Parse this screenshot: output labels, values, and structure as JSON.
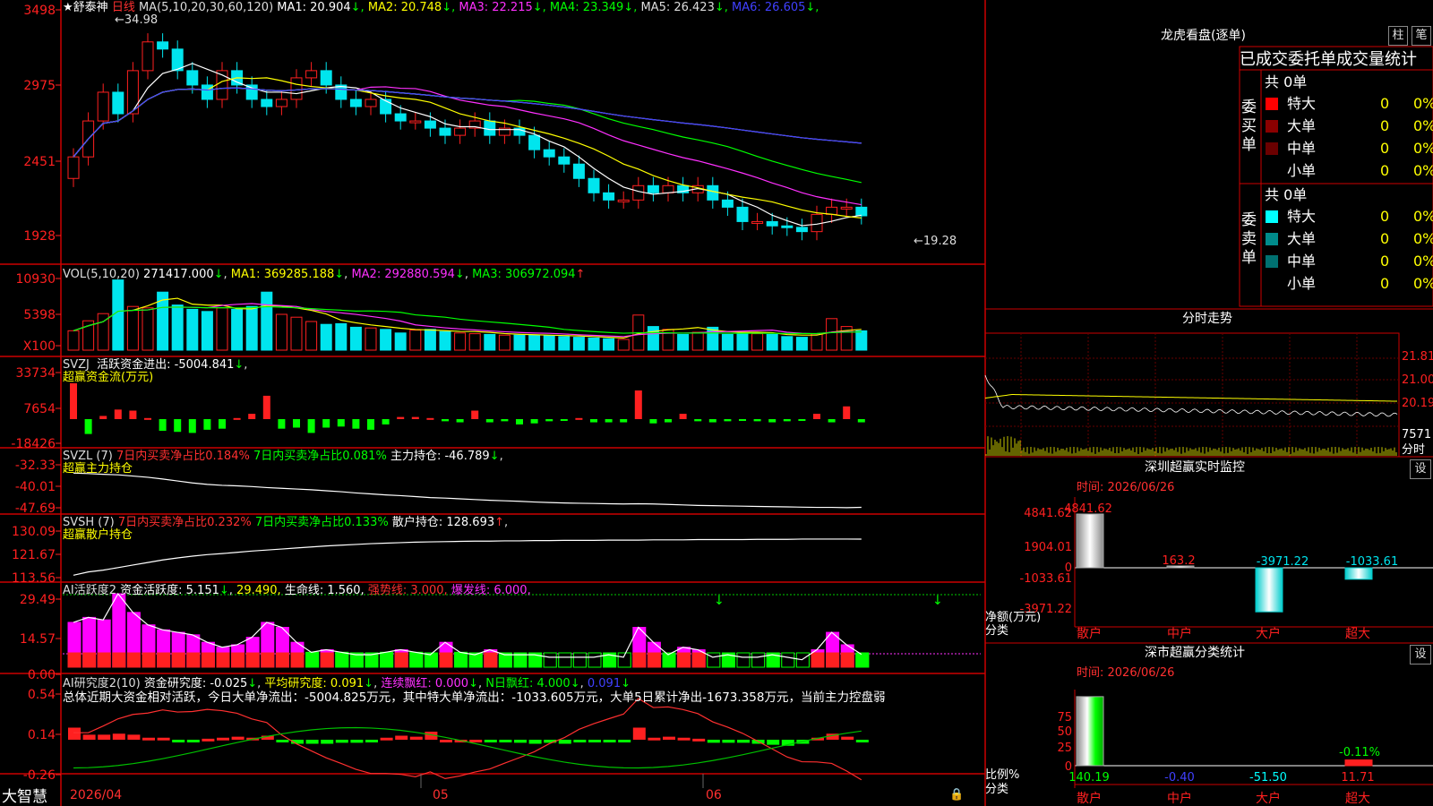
{
  "app": {
    "name": "大智慧",
    "date_tick": "2026/04",
    "month_labels": [
      "05",
      "06"
    ]
  },
  "main": {
    "stock": "舒泰神",
    "period": "日线",
    "ma_prefix": "MA(5,10,20,30,60,120)",
    "ma": [
      {
        "label": "MA1:",
        "value": "20.904",
        "arrow": "↓",
        "color": "#ffffff"
      },
      {
        "label": "MA2:",
        "value": "20.748",
        "arrow": "↓",
        "color": "#ffff00"
      },
      {
        "label": "MA3:",
        "value": "22.215",
        "arrow": "↓",
        "color": "#ff30ff"
      },
      {
        "label": "MA4:",
        "value": "23.349",
        "arrow": "↓",
        "color": "#00ff00"
      },
      {
        "label": "MA5:",
        "value": "26.423",
        "arrow": "↓",
        "color": "#dddddd"
      },
      {
        "label": "MA6:",
        "value": "26.605",
        "arrow": "↓",
        "color": "#4040ff"
      }
    ],
    "yticks": [
      "3498",
      "2975",
      "2451",
      "1928"
    ],
    "high_label": "34.98",
    "low_label": "19.28"
  },
  "vol": {
    "title": "VOL(5,10,20)",
    "value": "271417.000",
    "arrow": "↓",
    "ma1": "MA1: 369285.188",
    "ma2": "MA2: 292880.594",
    "ma3": "MA3: 306972.094",
    "yticks": [
      "10930",
      "5398",
      "X100"
    ]
  },
  "svzj": {
    "title": "SVZJ",
    "desc": "活跃资金进出: -5004.841",
    "sub": "超赢资金流(万元)",
    "yticks": [
      "33734",
      "7654",
      "-18426"
    ]
  },
  "svzl": {
    "title": "SVZL (7)",
    "a": "7日内买卖净占比0.184%",
    "b": "7日内买卖净占比0.081%",
    "c": "主力持仓: -46.789",
    "sub": "超赢主力持仓",
    "yticks": [
      "-32.33",
      "-40.01",
      "-47.69"
    ]
  },
  "svsh": {
    "title": "SVSH (7)",
    "a": "7日内买卖净占比0.232%",
    "b": "7日内买卖净占比0.133%",
    "c": "散户持仓: 128.693",
    "sub": "超赢散户持仓",
    "yticks": [
      "130.09",
      "121.67",
      "113.56"
    ]
  },
  "ai_active": {
    "title": "AI活跃度2",
    "a": "资金活跃度: 5.151",
    "b": "29.490,",
    "c": "生命线: 1.560,",
    "d": "强势线: 3.000,",
    "e": "爆发线: 6.000,",
    "yticks": [
      "29.49",
      "14.57",
      "0.00"
    ]
  },
  "ai_research": {
    "title": "AI研究度2(10)",
    "a": "资金研究度: -0.025",
    "b": "平均研究度: 0.091",
    "c": "连续飘红: 0.000",
    "d": "N日飘红: 4.000",
    "e": "0.091",
    "summary": "总体近期大资金相对活跃，今日大单净流出：-5004.825万元，其中特大单净流出：-1033.605万元，大单5日累计净出-1673.358万元，当前主力控盘弱",
    "yticks": [
      "0.54",
      "0.14",
      "-0.26"
    ]
  },
  "right": {
    "lhb_title": "龙虎看盘(逐单)",
    "btn_zhu": "柱",
    "btn_bi": "笔",
    "stat_title": "已成交委托单成交量统计",
    "buy": {
      "label": [
        "委",
        "买",
        "单"
      ],
      "total": "共 0单",
      "rows": [
        {
          "name": "特大",
          "vol": "0",
          "pct": "0%",
          "color": "#ff0000"
        },
        {
          "name": "大单",
          "vol": "0",
          "pct": "0%",
          "color": "#8b0000"
        },
        {
          "name": "中单",
          "vol": "0",
          "pct": "0%",
          "color": "#6b0000"
        },
        {
          "name": "小单",
          "vol": "0",
          "pct": "0%",
          "color": ""
        }
      ]
    },
    "sell": {
      "label": [
        "委",
        "卖",
        "单"
      ],
      "total": "共 0单",
      "rows": [
        {
          "name": "特大",
          "vol": "0",
          "pct": "0%",
          "color": "#00ffff"
        },
        {
          "name": "大单",
          "vol": "0",
          "pct": "0%",
          "color": "#008b8b"
        },
        {
          "name": "中单",
          "vol": "0",
          "pct": "0%",
          "color": "#007070"
        },
        {
          "name": "小单",
          "vol": "0",
          "pct": "0%",
          "color": ""
        }
      ]
    },
    "fs_title": "分时走势",
    "fs_yticks": [
      "21.81",
      "21.00",
      "20.19",
      "7571",
      "分时"
    ],
    "monitor": {
      "title": "深圳超赢实时监控",
      "btn": "设",
      "time": "时间: 2026/06/26",
      "yticks": [
        "4841.62",
        "1904.01",
        "0",
        "-1033.61",
        "-3971.22"
      ],
      "unit": "净额(万元)",
      "unit2": "分类",
      "bars": [
        {
          "name": "散户",
          "value": 4841.62,
          "label": "4841.62"
        },
        {
          "name": "中户",
          "value": 163.2,
          "label": "163.2"
        },
        {
          "name": "大户",
          "value": -3971.22,
          "label": "-3971.22"
        },
        {
          "name": "超大",
          "value": -1033.61,
          "label": "-1033.61"
        }
      ]
    },
    "cls": {
      "title": "深市超赢分类统计",
      "btn": "设",
      "time": "时间: 2026/06/26",
      "yticks": [
        "75",
        "50",
        "25",
        "0"
      ],
      "unit": "比例%",
      "unit2": "分类",
      "top_label": "-0.11%",
      "bars": [
        {
          "name": "散户",
          "value": 140.19,
          "label": "140.19"
        },
        {
          "name": "中户",
          "value": -0.4,
          "label": "-0.40"
        },
        {
          "name": "大户",
          "value": -51.5,
          "label": "-51.50"
        },
        {
          "name": "超大",
          "value": 11.71,
          "label": "11.71"
        }
      ]
    }
  },
  "chart_data": [
    {
      "type": "candlestick",
      "title": "舒泰神 日线",
      "ylim": [
        19.28,
        34.98
      ],
      "high": 34.98,
      "low": 19.28,
      "closes": [
        25,
        27.5,
        29.5,
        28,
        31,
        33,
        32.5,
        31,
        30,
        29,
        31,
        30,
        29,
        28.5,
        29,
        30.5,
        31,
        30,
        29,
        28.5,
        29,
        28,
        27.5,
        27.5,
        27,
        26.5,
        27,
        27.5,
        26.5,
        27,
        26.5,
        25.5,
        25,
        24.5,
        23.5,
        22.5,
        22,
        22,
        23,
        22.5,
        23,
        22.5,
        23,
        22,
        21.5,
        20.5,
        20.5,
        20.2,
        20.1,
        19.8,
        21,
        21.5,
        21.5,
        20.9
      ]
    },
    {
      "type": "bar",
      "title": "VOL(5,10,20)",
      "values": [
        2710,
        4100,
        5100,
        9800,
        6100,
        5900,
        8100,
        6300,
        5700,
        5400,
        5900,
        5700,
        6100,
        8100,
        5000,
        4600,
        4000,
        3600,
        3700,
        3200,
        3100,
        2900,
        2400,
        2800,
        2900,
        2600,
        2400,
        2300,
        2200,
        2100,
        2100,
        2100,
        2000,
        1900,
        1800,
        1700,
        1600,
        1500,
        4900,
        3300,
        2900,
        2200,
        2500,
        3200,
        2200,
        2300,
        2300,
        2200,
        1900,
        1800,
        2300,
        4400,
        3300,
        2700
      ]
    },
    {
      "type": "bar",
      "title": "SVZJ",
      "values": [
        33734,
        -14000,
        3000,
        9000,
        8000,
        1000,
        -11000,
        -12000,
        -13000,
        -10000,
        -9000,
        1000,
        5000,
        22000,
        -9000,
        -8000,
        -13000,
        -8000,
        -7000,
        -9000,
        -10000,
        -5000,
        2000,
        2000,
        1000,
        -2000,
        -3000,
        8000,
        -3000,
        -2000,
        -5000,
        -4000,
        -2000,
        -1000,
        1000,
        -3000,
        -3000,
        -3000,
        27000,
        -4000,
        -3000,
        5000,
        -2000,
        -3000,
        -2000,
        -1000,
        -2000,
        -3000,
        -2000,
        -1000,
        5000,
        -3000,
        12000,
        -3000
      ]
    },
    {
      "type": "line",
      "title": "SVZL",
      "ylim": [
        -47.69,
        -32.33
      ],
      "values": [
        -32.8,
        -33,
        -33.3,
        -33.5,
        -34,
        -34.5,
        -35.2,
        -36,
        -36.8,
        -37.4,
        -37.8,
        -38,
        -38.3,
        -38.7,
        -39,
        -39.3,
        -39.6,
        -40,
        -40.4,
        -40.9,
        -41.3,
        -41.7,
        -42,
        -42.4,
        -42.8,
        -43,
        -43.3,
        -43.6,
        -43.9,
        -44.1,
        -44.3,
        -44.6,
        -44.8,
        -45,
        -45.1,
        -45.2,
        -45.3,
        -45.4,
        -45.3,
        -45.4,
        -45.6,
        -45.8,
        -46,
        -46.1,
        -46.2,
        -46.3,
        -46.4,
        -46.5,
        -46.6,
        -46.7,
        -46.8,
        -46.8,
        -46.9,
        -46.789
      ]
    },
    {
      "type": "line",
      "title": "SVSH",
      "ylim": [
        113.56,
        130.09
      ],
      "values": [
        114.5,
        115.8,
        116.5,
        117.5,
        118.5,
        119.5,
        120.5,
        121.3,
        122,
        122.6,
        123,
        123.5,
        124,
        124.4,
        124.8,
        125.2,
        125.6,
        126,
        126.3,
        126.6,
        126.9,
        127.1,
        127.3,
        127.5,
        127.6,
        127.7,
        127.8,
        127.9,
        127.9,
        128,
        128,
        128.1,
        128.1,
        128.2,
        128.2,
        128.2,
        128.3,
        128.3,
        128.3,
        128.4,
        128.4,
        128.4,
        128.5,
        128.5,
        128.5,
        128.5,
        128.6,
        128.6,
        128.6,
        128.7,
        128.7,
        128.7,
        128.7,
        128.693
      ]
    },
    {
      "type": "bar",
      "title": "AI活跃度2",
      "values": [
        18,
        20,
        19,
        29.49,
        22,
        17,
        15,
        14,
        13,
        10,
        8,
        9,
        12,
        18,
        16,
        10,
        6,
        7,
        6,
        5,
        5,
        6,
        7,
        6,
        5,
        10,
        6,
        5,
        7,
        5,
        5,
        5,
        4,
        4,
        4,
        4,
        5,
        4,
        16,
        10,
        5,
        8,
        7,
        4,
        5,
        4,
        4,
        5,
        4,
        3,
        7,
        14,
        9,
        5.151
      ]
    },
    {
      "type": "bar",
      "title": "AI研究度2",
      "values": [
        0.12,
        0.05,
        0.05,
        0.06,
        0.05,
        0.02,
        0.02,
        -0.02,
        -0.02,
        0.01,
        0.02,
        0.03,
        0.02,
        0.04,
        -0.02,
        -0.04,
        -0.04,
        -0.04,
        -0.03,
        -0.03,
        -0.02,
        0.02,
        0.04,
        0.03,
        0.08,
        0,
        0,
        0,
        -0.02,
        -0.02,
        -0.03,
        -0.04,
        -0.03,
        -0.04,
        -0.02,
        -0.02,
        -0.02,
        -0.01,
        0.12,
        0.02,
        0.03,
        0.02,
        0.01,
        -0.03,
        -0.03,
        -0.03,
        -0.04,
        -0.05,
        -0.06,
        -0.04,
        0.02,
        0.06,
        0.03,
        -0.025
      ]
    }
  ]
}
